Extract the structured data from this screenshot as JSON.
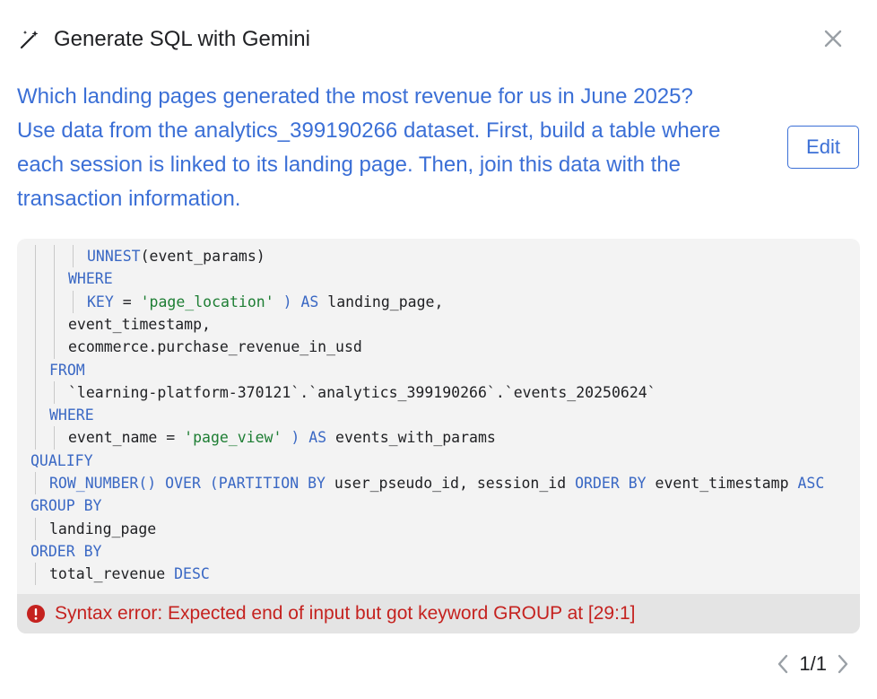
{
  "dialog": {
    "title": "Generate SQL with Gemini",
    "icons": {
      "wand": "magic-wand-icon",
      "close": "close-icon"
    }
  },
  "prompt": {
    "lines": [
      "Which landing pages generated the most revenue for us in June 2025?",
      "Use data from the analytics_399190266 dataset. First, build a table where",
      "each session is linked to its landing page. Then, join this data with the",
      "transaction information."
    ],
    "edit_label": "Edit"
  },
  "code": {
    "lines": [
      {
        "indent": 3,
        "tokens": [
          {
            "t": "UNNEST",
            "c": "kw"
          },
          {
            "t": "(event_params)",
            "c": ""
          }
        ]
      },
      {
        "indent": 2,
        "tokens": [
          {
            "t": "WHERE",
            "c": "kw"
          }
        ]
      },
      {
        "indent": 3,
        "tokens": [
          {
            "t": "KEY",
            "c": "kw"
          },
          {
            "t": " = ",
            "c": ""
          },
          {
            "t": "'page_location'",
            "c": "str"
          },
          {
            "t": " ) ",
            "c": "kw"
          },
          {
            "t": "AS",
            "c": "kw"
          },
          {
            "t": " landing_page,",
            "c": ""
          }
        ]
      },
      {
        "indent": 2,
        "tokens": [
          {
            "t": "event_timestamp,",
            "c": ""
          }
        ]
      },
      {
        "indent": 2,
        "tokens": [
          {
            "t": "ecommerce.purchase_revenue_in_usd",
            "c": ""
          }
        ]
      },
      {
        "indent": 1,
        "tokens": [
          {
            "t": "FROM",
            "c": "kw"
          }
        ]
      },
      {
        "indent": 2,
        "tokens": [
          {
            "t": "`learning-platform-370121`.`analytics_399190266`.`events_20250624`",
            "c": ""
          }
        ]
      },
      {
        "indent": 1,
        "tokens": [
          {
            "t": "WHERE",
            "c": "kw"
          }
        ]
      },
      {
        "indent": 2,
        "tokens": [
          {
            "t": "event_name = ",
            "c": ""
          },
          {
            "t": "'page_view'",
            "c": "str"
          },
          {
            "t": " ) ",
            "c": "kw"
          },
          {
            "t": "AS",
            "c": "kw"
          },
          {
            "t": " events_with_params",
            "c": ""
          }
        ]
      },
      {
        "indent": 0,
        "tokens": [
          {
            "t": "QUALIFY",
            "c": "kw"
          }
        ]
      },
      {
        "indent": 1,
        "tokens": [
          {
            "t": "ROW_NUMBER() OVER (PARTITION BY",
            "c": "kw"
          },
          {
            "t": " user_pseudo_id, session_id ",
            "c": ""
          },
          {
            "t": "ORDER BY",
            "c": "kw"
          },
          {
            "t": " event_timestamp ",
            "c": ""
          },
          {
            "t": "ASC",
            "c": "kw"
          }
        ]
      },
      {
        "indent": 0,
        "tokens": [
          {
            "t": "GROUP BY",
            "c": "kw"
          }
        ]
      },
      {
        "indent": 1,
        "tokens": [
          {
            "t": "landing_page",
            "c": ""
          }
        ]
      },
      {
        "indent": 0,
        "tokens": [
          {
            "t": "ORDER BY",
            "c": "kw"
          }
        ]
      },
      {
        "indent": 1,
        "tokens": [
          {
            "t": "total_revenue ",
            "c": ""
          },
          {
            "t": "DESC",
            "c": "kw"
          }
        ]
      }
    ]
  },
  "error": {
    "icon": "error-icon",
    "message": "Syntax error: Expected end of input but got keyword GROUP at [29:1]"
  },
  "pager": {
    "label": "1/1",
    "icons": {
      "prev": "chevron-left-icon",
      "next": "chevron-right-icon"
    }
  },
  "colors": {
    "accent": "#3b6fd6",
    "error": "#c5221f",
    "keyword": "#3a68c4",
    "string": "#1e7e34"
  }
}
